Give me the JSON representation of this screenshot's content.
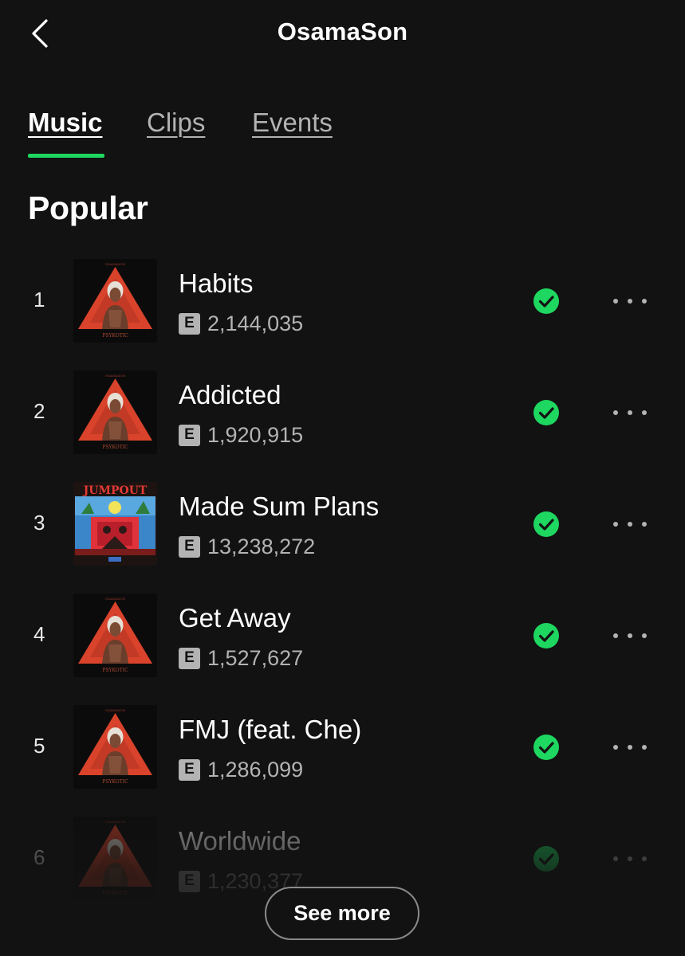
{
  "header": {
    "title": "OsamaSon",
    "back_icon": "chevron-left-icon"
  },
  "tabs": [
    {
      "label": "Music",
      "active": true
    },
    {
      "label": "Clips",
      "active": false
    },
    {
      "label": "Events",
      "active": false
    }
  ],
  "colors": {
    "background": "#121212",
    "accent": "#1ed760",
    "secondary_text": "#b3b3b3"
  },
  "popular": {
    "title": "Popular",
    "tracks": [
      {
        "rank": "1",
        "title": "Habits",
        "explicit": "E",
        "plays": "2,144,035",
        "cover": "psykotic-cover",
        "saved": true
      },
      {
        "rank": "2",
        "title": "Addicted",
        "explicit": "E",
        "plays": "1,920,915",
        "cover": "psykotic-cover",
        "saved": true
      },
      {
        "rank": "3",
        "title": "Made Sum Plans",
        "explicit": "E",
        "plays": "13,238,272",
        "cover": "jump-out-cover",
        "saved": true
      },
      {
        "rank": "4",
        "title": "Get Away",
        "explicit": "E",
        "plays": "1,527,627",
        "cover": "psykotic-cover",
        "saved": true
      },
      {
        "rank": "5",
        "title": "FMJ (feat. Che)",
        "explicit": "E",
        "plays": "1,286,099",
        "cover": "psykotic-cover",
        "saved": true
      },
      {
        "rank": "6",
        "title": "Worldwide",
        "explicit": "E",
        "plays": "1,230,377",
        "cover": "psykotic-cover",
        "saved": true
      }
    ],
    "see_more_label": "See more"
  }
}
